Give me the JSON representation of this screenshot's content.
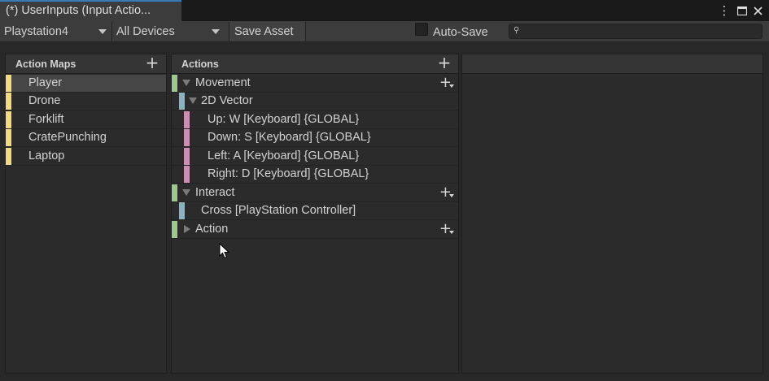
{
  "window": {
    "tab_title": "(*) UserInputs (Input Actio...",
    "menu_glyph": "⋮",
    "maximize_glyph": "☐",
    "close_glyph": "✕"
  },
  "toolbar": {
    "scheme_dropdown": "Playstation4",
    "device_dropdown": "All Devices",
    "save_asset": "Save Asset",
    "auto_save_label": "Auto-Save",
    "auto_save_checked": false,
    "search_value": "",
    "search_glyph": "⚲"
  },
  "action_maps": {
    "title": "Action Maps",
    "add_glyph": "+",
    "items": [
      {
        "label": "Player",
        "selected": true
      },
      {
        "label": "Drone",
        "selected": false
      },
      {
        "label": "Forklift",
        "selected": false
      },
      {
        "label": "CratePunching",
        "selected": false
      },
      {
        "label": "Laptop",
        "selected": false
      }
    ]
  },
  "actions": {
    "title": "Actions",
    "add_glyph": "+",
    "row_add_glyph": "+",
    "rows": [
      {
        "kind": "action",
        "label": "Movement",
        "expanded": true
      },
      {
        "kind": "composite",
        "label": "2D Vector",
        "expanded": true
      },
      {
        "kind": "part",
        "label": "Up: W [Keyboard] {GLOBAL}"
      },
      {
        "kind": "part",
        "label": "Down: S [Keyboard] {GLOBAL}"
      },
      {
        "kind": "part",
        "label": "Left: A [Keyboard] {GLOBAL}"
      },
      {
        "kind": "part",
        "label": "Right: D [Keyboard] {GLOBAL}"
      },
      {
        "kind": "action",
        "label": "Interact",
        "expanded": true
      },
      {
        "kind": "binding",
        "label": "Cross [PlayStation Controller]"
      },
      {
        "kind": "action",
        "label": "Action",
        "expanded": false
      }
    ]
  },
  "colors": {
    "action_map_bar": "#f3d980",
    "action_bar": "#9bc98b",
    "binding_bar": "#8fb1bd",
    "part_bar": "#cb8fb2",
    "tab_accent": "#3a79bb"
  }
}
